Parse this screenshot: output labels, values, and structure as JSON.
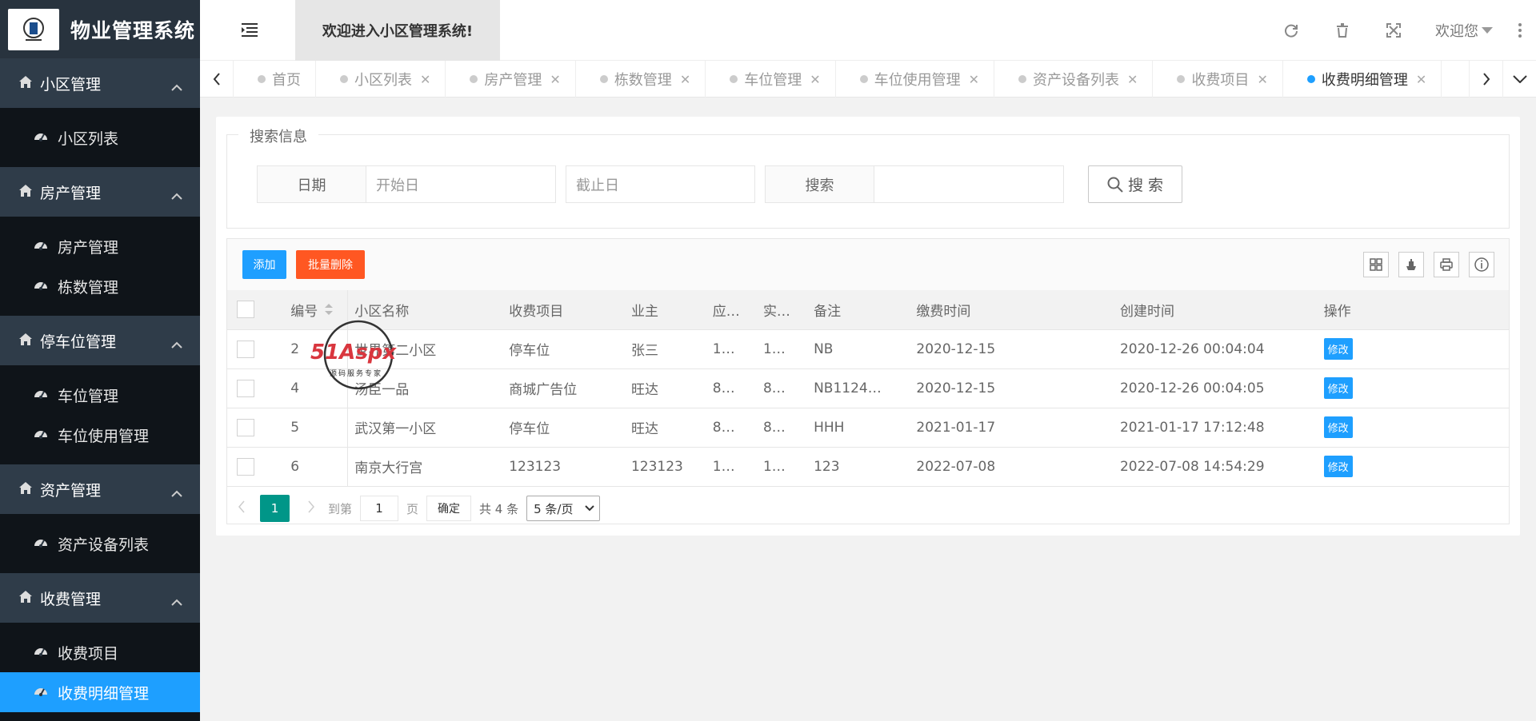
{
  "app": {
    "title": "物业管理系统",
    "welcome": "欢迎进入小区管理系统!",
    "user": "欢迎您"
  },
  "sidebar": {
    "groups": [
      {
        "label": "小区管理",
        "items": [
          "小区列表"
        ]
      },
      {
        "label": "房产管理",
        "items": [
          "房产管理",
          "栋数管理"
        ]
      },
      {
        "label": "停车位管理",
        "items": [
          "车位管理",
          "车位使用管理"
        ]
      },
      {
        "label": "资产管理",
        "items": [
          "资产设备列表"
        ]
      },
      {
        "label": "收费管理",
        "items": [
          "收费项目",
          "收费明细管理"
        ]
      }
    ],
    "active_item": "收费明细管理"
  },
  "tabs": [
    {
      "label": "首页",
      "closable": false
    },
    {
      "label": "小区列表",
      "closable": true
    },
    {
      "label": "房产管理",
      "closable": true
    },
    {
      "label": "栋数管理",
      "closable": true
    },
    {
      "label": "车位管理",
      "closable": true
    },
    {
      "label": "车位使用管理",
      "closable": true
    },
    {
      "label": "资产设备列表",
      "closable": true
    },
    {
      "label": "收费项目",
      "closable": true
    },
    {
      "label": "收费明细管理",
      "closable": true
    }
  ],
  "search": {
    "legend": "搜索信息",
    "date_label": "日期",
    "start_placeholder": "开始日",
    "end_placeholder": "截止日",
    "keyword_label": "搜索",
    "keyword_value": "",
    "button": "搜 索"
  },
  "toolbar": {
    "add": "添加",
    "batch_delete": "批量删除"
  },
  "table": {
    "columns": [
      "编号",
      "小区名称",
      "收费项目",
      "业主",
      "应…",
      "实…",
      "备注",
      "缴费时间",
      "创建时间",
      "操作"
    ],
    "rows": [
      [
        "2",
        "世界第二小区",
        "停车位",
        "张三",
        "1…",
        "1…",
        "NB",
        "2020-12-15",
        "2020-12-26 00:04:04",
        "修改"
      ],
      [
        "4",
        "汤臣一品",
        "商城广告位",
        "旺达",
        "8…",
        "8…",
        "NB1124…",
        "2020-12-15",
        "2020-12-26 00:04:05",
        "修改"
      ],
      [
        "5",
        "武汉第一小区",
        "停车位",
        "旺达",
        "8…",
        "8…",
        "HHH",
        "2021-01-17",
        "2021-01-17 17:12:48",
        "修改"
      ],
      [
        "6",
        "南京大行宫",
        "123123",
        "123123",
        "1…",
        "1…",
        "123",
        "2022-07-08",
        "2022-07-08 14:54:29",
        "修改"
      ]
    ]
  },
  "pager": {
    "current": "1",
    "goto_label": "到第",
    "goto_value": "1",
    "page_label": "页",
    "confirm": "确定",
    "total": "共 4 条",
    "page_size": "5 条/页"
  },
  "watermark": {
    "brand": "51Aspx",
    "slogan": "源码服务专家"
  },
  "colors": {
    "sidebar_bg": "#28333e",
    "active_blue": "#1e9fff",
    "danger": "#ff5722",
    "pager_green": "#009688"
  }
}
